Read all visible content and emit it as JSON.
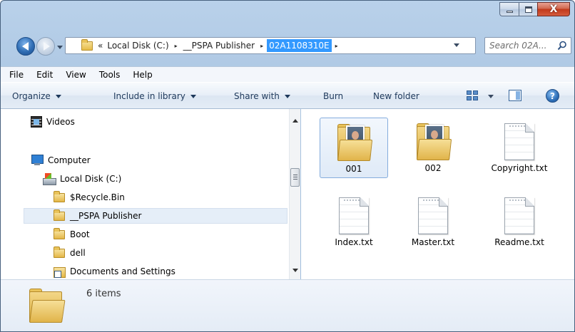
{
  "window": {
    "caption_buttons": {
      "close_glyph": "X"
    }
  },
  "address_bar": {
    "prefix": "«",
    "crumbs": [
      "Local Disk (C:)",
      "__PSPA Publisher",
      "02A1108310E"
    ],
    "separator": "▸",
    "dropdown_icon": "chevron-down-icon"
  },
  "search": {
    "placeholder": "Search 02A..."
  },
  "menu": [
    "File",
    "Edit",
    "View",
    "Tools",
    "Help"
  ],
  "toolbar": {
    "organize": "Organize",
    "include_in_library": "Include in library",
    "share_with": "Share with",
    "burn": "Burn",
    "new_folder": "New folder",
    "help_glyph": "?"
  },
  "nav_tree": {
    "videos": "Videos",
    "computer": "Computer",
    "local_disk": "Local Disk (C:)",
    "recycle": "$Recycle.Bin",
    "pspa": "__PSPA Publisher",
    "boot": "Boot",
    "dell": "dell",
    "documents": "Documents and Settings"
  },
  "files": [
    {
      "name": "001",
      "type": "folder",
      "selected": true
    },
    {
      "name": "002",
      "type": "folder",
      "selected": false
    },
    {
      "name": "Copyright.txt",
      "type": "text",
      "selected": false
    },
    {
      "name": "Index.txt",
      "type": "text",
      "selected": false
    },
    {
      "name": "Master.txt",
      "type": "text",
      "selected": false
    },
    {
      "name": "Readme.txt",
      "type": "text",
      "selected": false
    }
  ],
  "details": {
    "item_count": "6 items"
  },
  "colors": {
    "chrome": "#a7c2df",
    "selection": "#3399ff",
    "command_text": "#1e395b",
    "close_button": "#c2391b"
  }
}
